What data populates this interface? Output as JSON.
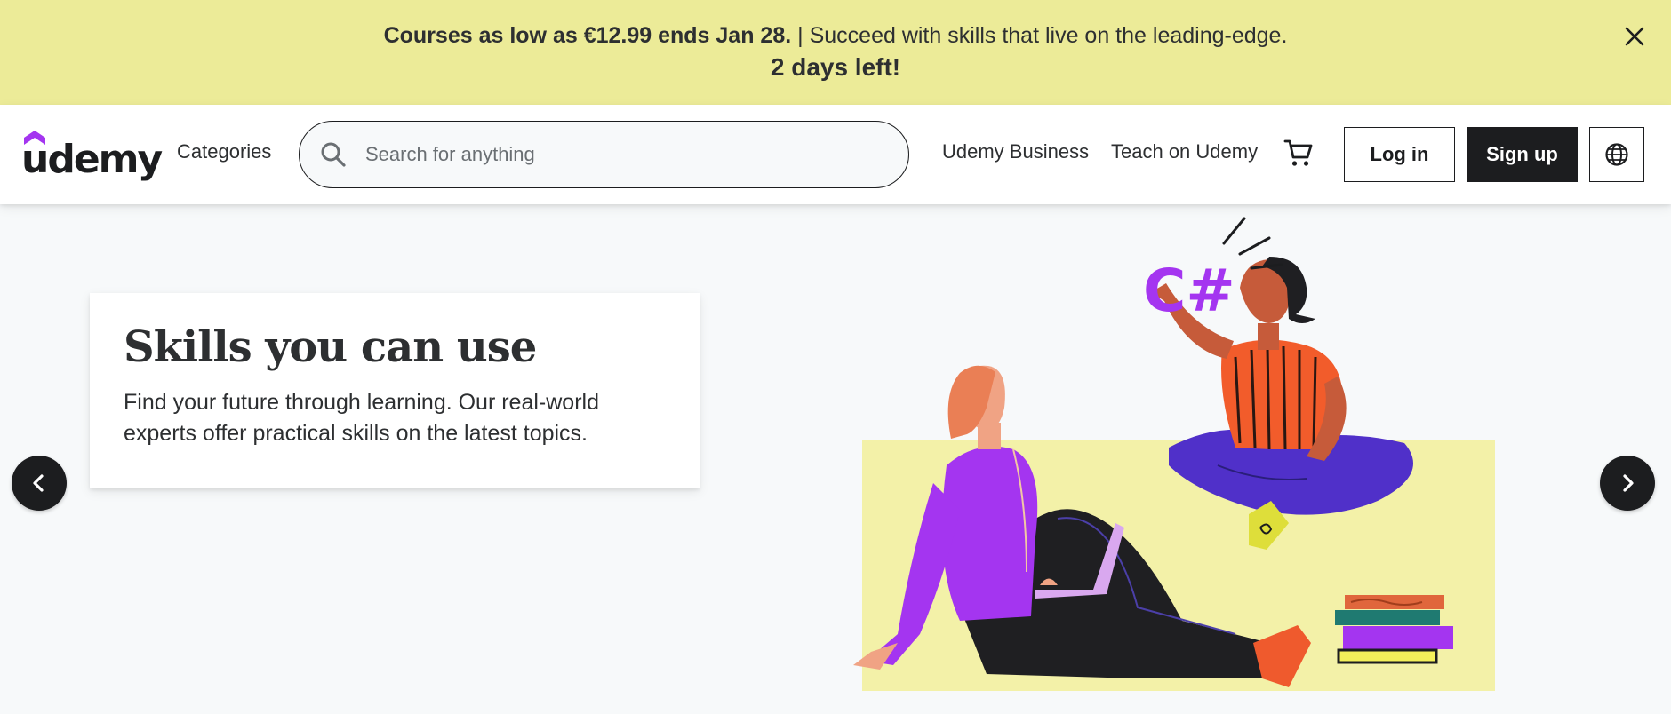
{
  "banner": {
    "promo_bold": "Courses as low as €12.99 ends Jan 28.",
    "promo_text": "| Succeed with skills that live on the leading-edge.",
    "countdown": "2 days left!",
    "close_icon": "close-icon"
  },
  "header": {
    "logo_text": "ûdemy",
    "categories_label": "Categories",
    "search": {
      "placeholder": "Search for anything",
      "value": ""
    },
    "business_label": "Udemy Business",
    "teach_label": "Teach on Udemy",
    "cart_icon": "cart-icon",
    "login_label": "Log in",
    "signup_label": "Sign up",
    "language_icon": "globe-icon"
  },
  "hero": {
    "title": "Skills you can use",
    "subtitle": "Find your future through learning. Our real-world experts offer practical skills on the latest topics.",
    "badge_text": "C#",
    "prev_icon": "chevron-left-icon",
    "next_icon": "chevron-right-icon"
  },
  "colors": {
    "banner_bg": "#eceb98",
    "dark": "#1c1d1f",
    "brand_purple": "#a435f0",
    "page_bg": "#f7f9fa"
  }
}
